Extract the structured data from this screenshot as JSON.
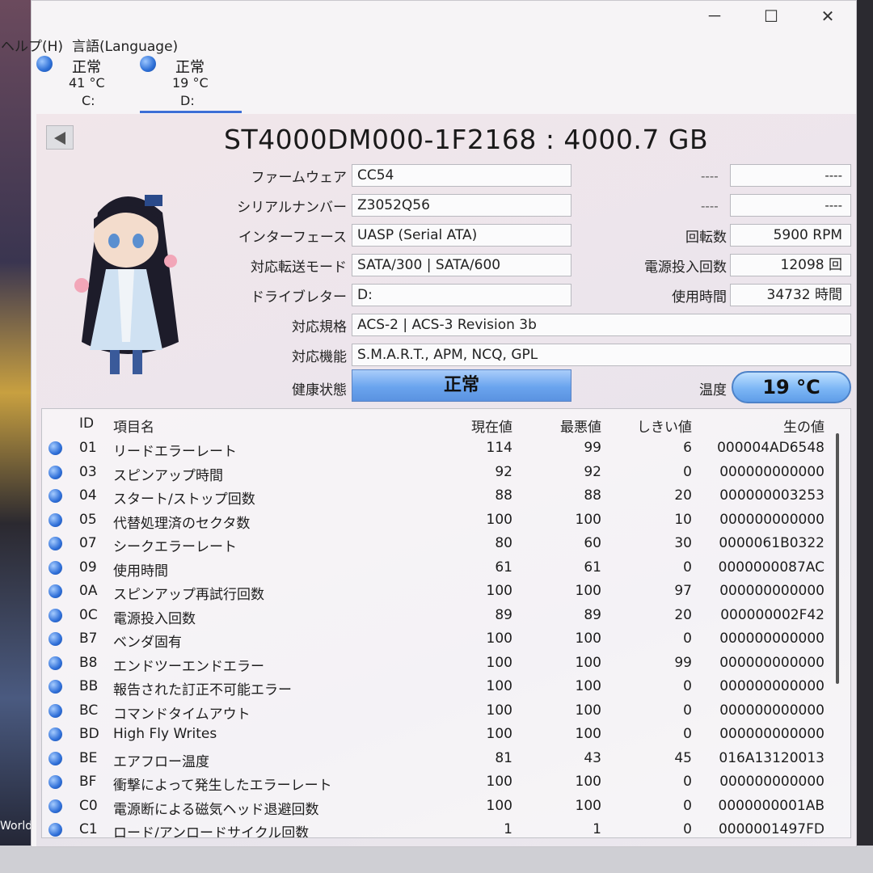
{
  "menu": {
    "help": "ヘルプ(H)",
    "language": "言語(Language)"
  },
  "window": {
    "minimize": "－",
    "maximize": "☐",
    "close": "✕"
  },
  "desktop": {
    "partial_text": "World"
  },
  "disks": [
    {
      "status": "正常",
      "temp": "41 °C",
      "letter": "C:"
    },
    {
      "status": "正常",
      "temp": "19 °C",
      "letter": "D:"
    }
  ],
  "drive": {
    "model": "ST4000DM000-1F2168 : 4000.7 GB",
    "firmware_label": "ファームウェア",
    "firmware": "CC54",
    "serial_label": "シリアルナンバー",
    "serial": "Z3052Q56",
    "interface_label": "インターフェース",
    "interface": "UASP (Serial ATA)",
    "transfer_label": "対応転送モード",
    "transfer": "SATA/300 | SATA/600",
    "letter_label": "ドライブレター",
    "letter": "D:",
    "standard_label": "対応規格",
    "standard": "ACS-2 | ACS-3 Revision 3b",
    "features_label": "対応機能",
    "features": "S.M.A.R.T., APM, NCQ, GPL",
    "health_label": "健康状態",
    "health": "正常",
    "temp_label": "温度",
    "temp": "19 °C",
    "dash1a": "----",
    "dash1b": "----",
    "dash2a": "----",
    "dash2b": "----",
    "rpm_label": "回転数",
    "rpm": "5900 RPM",
    "power_count_label": "電源投入回数",
    "power_count": "12098 回",
    "hours_label": "使用時間",
    "hours": "34732 時間"
  },
  "smart": {
    "headers": {
      "id": "ID",
      "name": "項目名",
      "current": "現在値",
      "worst": "最悪値",
      "threshold": "しきい値",
      "raw": "生の値"
    },
    "rows": [
      {
        "id": "01",
        "name": "リードエラーレート",
        "current": "114",
        "worst": "99",
        "threshold": "6",
        "raw": "000004AD6548"
      },
      {
        "id": "03",
        "name": "スピンアップ時間",
        "current": "92",
        "worst": "92",
        "threshold": "0",
        "raw": "000000000000"
      },
      {
        "id": "04",
        "name": "スタート/ストップ回数",
        "current": "88",
        "worst": "88",
        "threshold": "20",
        "raw": "000000003253"
      },
      {
        "id": "05",
        "name": "代替処理済のセクタ数",
        "current": "100",
        "worst": "100",
        "threshold": "10",
        "raw": "000000000000"
      },
      {
        "id": "07",
        "name": "シークエラーレート",
        "current": "80",
        "worst": "60",
        "threshold": "30",
        "raw": "0000061B0322"
      },
      {
        "id": "09",
        "name": "使用時間",
        "current": "61",
        "worst": "61",
        "threshold": "0",
        "raw": "0000000087AC"
      },
      {
        "id": "0A",
        "name": "スピンアップ再試行回数",
        "current": "100",
        "worst": "100",
        "threshold": "97",
        "raw": "000000000000"
      },
      {
        "id": "0C",
        "name": "電源投入回数",
        "current": "89",
        "worst": "89",
        "threshold": "20",
        "raw": "000000002F42"
      },
      {
        "id": "B7",
        "name": "ベンダ固有",
        "current": "100",
        "worst": "100",
        "threshold": "0",
        "raw": "000000000000"
      },
      {
        "id": "B8",
        "name": "エンドツーエンドエラー",
        "current": "100",
        "worst": "100",
        "threshold": "99",
        "raw": "000000000000"
      },
      {
        "id": "BB",
        "name": "報告された訂正不可能エラー",
        "current": "100",
        "worst": "100",
        "threshold": "0",
        "raw": "000000000000"
      },
      {
        "id": "BC",
        "name": "コマンドタイムアウト",
        "current": "100",
        "worst": "100",
        "threshold": "0",
        "raw": "000000000000"
      },
      {
        "id": "BD",
        "name": "High Fly Writes",
        "current": "100",
        "worst": "100",
        "threshold": "0",
        "raw": "000000000000"
      },
      {
        "id": "BE",
        "name": "エアフロー温度",
        "current": "81",
        "worst": "43",
        "threshold": "45",
        "raw": "016A13120013"
      },
      {
        "id": "BF",
        "name": "衝撃によって発生したエラーレート",
        "current": "100",
        "worst": "100",
        "threshold": "0",
        "raw": "000000000000"
      },
      {
        "id": "C0",
        "name": "電源断による磁気ヘッド退避回数",
        "current": "100",
        "worst": "100",
        "threshold": "0",
        "raw": "0000000001AB"
      },
      {
        "id": "C1",
        "name": "ロード/アンロードサイクル回数",
        "current": "1",
        "worst": "1",
        "threshold": "0",
        "raw": "0000001497FD"
      }
    ]
  }
}
